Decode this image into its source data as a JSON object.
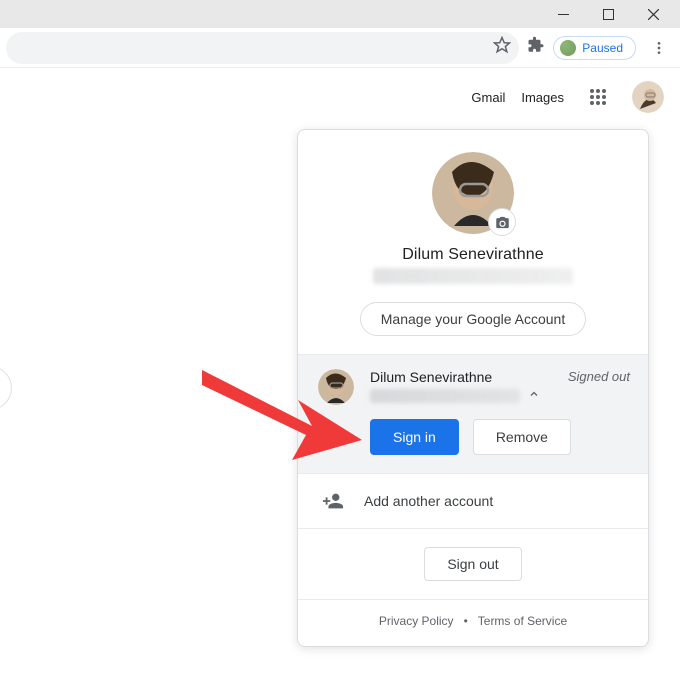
{
  "window": {
    "minimize": "–",
    "maximize": "☐",
    "close": "×"
  },
  "toolbar": {
    "paused_label": "Paused"
  },
  "gtop": {
    "gmail_label": "Gmail",
    "images_label": "Images"
  },
  "account_popup": {
    "primary": {
      "name": "Dilum Senevirathne",
      "email_redacted": "",
      "manage_label": "Manage your Google Account"
    },
    "other": {
      "name": "Dilum Senevirathne",
      "email_redacted": "",
      "status": "Signed out",
      "signin_label": "Sign in",
      "remove_label": "Remove"
    },
    "add_label": "Add another account",
    "signout_label": "Sign out",
    "legal": {
      "privacy": "Privacy Policy",
      "terms": "Terms of Service"
    }
  }
}
